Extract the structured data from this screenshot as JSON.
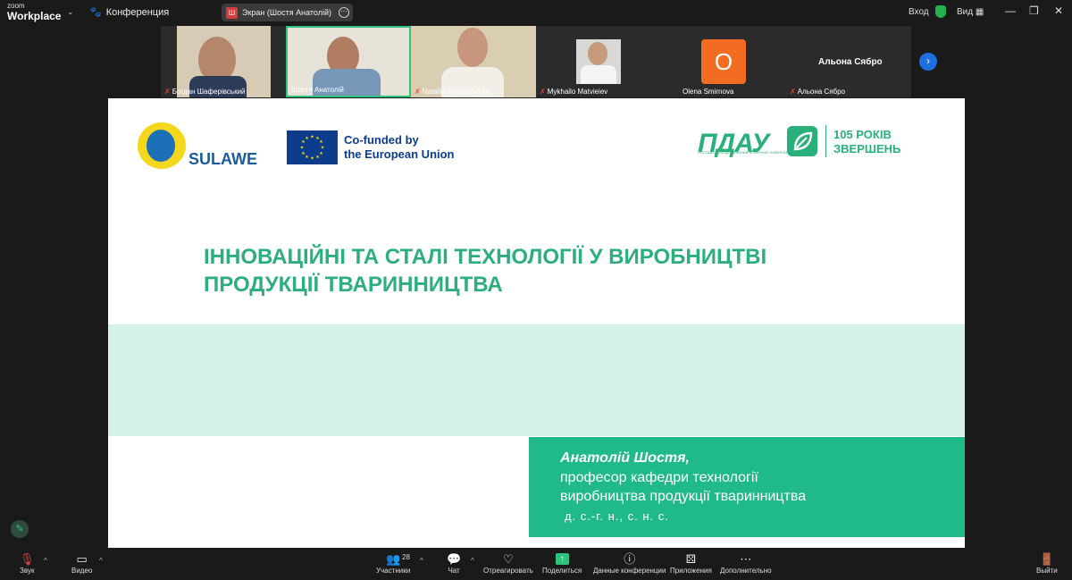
{
  "app": {
    "brand_top": "zoom",
    "brand_bottom": "Workplace",
    "meeting_label": "Конференция"
  },
  "share": {
    "avatar_letter": "Ш",
    "label": "Экран (Шостя Анатолій)",
    "more": "⋯"
  },
  "header": {
    "signin": "Вход",
    "view": "Вид"
  },
  "participants_strip": [
    {
      "name": "Богдан Шаферівський",
      "muted": true
    },
    {
      "name": "Шостя Анатолій",
      "muted": false,
      "active": true
    },
    {
      "name": "Natallia Hryshchenko",
      "muted": true
    },
    {
      "name": "Mykhailo Matvieiev",
      "muted": true
    },
    {
      "name": "Olena Smirnova",
      "muted": false,
      "avatar_letter": "O"
    },
    {
      "name": "Альона Сябро",
      "muted": true,
      "display_text": "Альона Сябро"
    }
  ],
  "slide": {
    "sulawe": "SULAWE",
    "eu_line1": "Co-funded by",
    "eu_line2": "the European Union",
    "pdau": "ПДАУ",
    "pdau_sub": "ПОЛТАВСЬКИЙ ДЕРЖАВНИЙ АГРАРНИЙ УНІВЕРСИТЕТ",
    "years_line1": "105 РОКІВ",
    "years_line2": "ЗВЕРШЕНЬ",
    "title_line1": "ІННОВАЦІЙНІ ТА СТАЛІ ТЕХНОЛОГІЇ У ВИРОБНИЦТВІ",
    "title_line2": "ПРОДУКЦІЇ ТВАРИННИЦТВА",
    "author_name": "Анатолій Шостя,",
    "author_role1": "професор кафедри технології",
    "author_role2": "виробництва продукції тваринництва",
    "author_degree": "д. с.-г. н., с. н. с."
  },
  "toolbar": {
    "audio": "Звук",
    "video": "Видео",
    "participants": "Участники",
    "participants_count": "28",
    "chat": "Чат",
    "react": "Отреагировать",
    "share": "Поделиться",
    "info": "Данные конференции",
    "apps": "Приложения",
    "more": "Дополнительно",
    "leave": "Выйти"
  },
  "colors": {
    "accent_green": "#2dae7f",
    "band": "#d5f2e8",
    "author_box": "#1fb98a",
    "eu_blue": "#0d3c8c"
  }
}
